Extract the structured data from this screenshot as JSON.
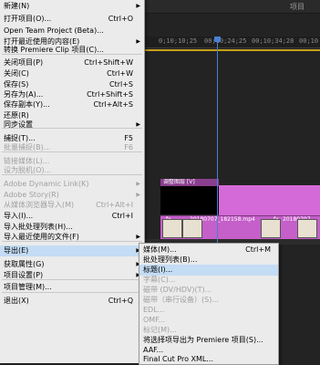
{
  "app": {
    "panel_title": "项目"
  },
  "timeline": {
    "timecodes": [
      "0;10;10;25",
      "00;10;24;25",
      "00;10;34;28",
      "00;10"
    ],
    "clip_label": "调整图层 [V]",
    "video_clip_labels": [
      "fx",
      "20180707_182158.mp4",
      "fx",
      "20180707_"
    ],
    "colors": {
      "playhead": "#4a7fd0",
      "clip": "#d46ad8",
      "workbar": "#c8a018"
    }
  },
  "file_menu": {
    "items": [
      {
        "label": "新建(N)",
        "shortcut": "",
        "submenu": true,
        "disabled": false
      },
      {
        "label": "打开项目(O)...",
        "shortcut": "Ctrl+O",
        "submenu": false,
        "disabled": false
      },
      {
        "label": "Open Team Project (Beta)...",
        "shortcut": "",
        "submenu": false,
        "disabled": false
      },
      {
        "label": "打开最近使用的内容(E)",
        "shortcut": "",
        "submenu": true,
        "disabled": false
      },
      {
        "label": "转换 Premiere Clip 项目(C)...",
        "shortcut": "",
        "submenu": false,
        "disabled": false
      },
      {
        "label": "关闭项目(P)",
        "shortcut": "Ctrl+Shift+W",
        "submenu": false,
        "disabled": false
      },
      {
        "label": "关闭(C)",
        "shortcut": "Ctrl+W",
        "submenu": false,
        "disabled": false
      },
      {
        "label": "保存(S)",
        "shortcut": "Ctrl+S",
        "submenu": false,
        "disabled": false
      },
      {
        "label": "另存为(A)...",
        "shortcut": "Ctrl+Shift+S",
        "submenu": false,
        "disabled": false
      },
      {
        "label": "保存副本(Y)...",
        "shortcut": "Ctrl+Alt+S",
        "submenu": false,
        "disabled": false
      },
      {
        "label": "还原(R)",
        "shortcut": "",
        "submenu": false,
        "disabled": false
      },
      {
        "label": "同步设置",
        "shortcut": "",
        "submenu": true,
        "disabled": false
      },
      {
        "label": "捕捉(T)...",
        "shortcut": "F5",
        "submenu": false,
        "disabled": false
      },
      {
        "label": "批量捕捉(B)...",
        "shortcut": "F6",
        "submenu": false,
        "disabled": true
      },
      {
        "label": "链接媒体(L)...",
        "shortcut": "",
        "submenu": false,
        "disabled": true
      },
      {
        "label": "设为脱机(O)...",
        "shortcut": "",
        "submenu": false,
        "disabled": true
      },
      {
        "label": "Adobe Dynamic Link(K)",
        "shortcut": "",
        "submenu": true,
        "disabled": true
      },
      {
        "label": "Adobe Story(R)",
        "shortcut": "",
        "submenu": true,
        "disabled": true
      },
      {
        "label": "从媒体浏览器导入(M)",
        "shortcut": "Ctrl+Alt+I",
        "submenu": false,
        "disabled": true
      },
      {
        "label": "导入(I)...",
        "shortcut": "Ctrl+I",
        "submenu": false,
        "disabled": false
      },
      {
        "label": "导入批处理列表(H)...",
        "shortcut": "",
        "submenu": false,
        "disabled": false
      },
      {
        "label": "导入最近使用的文件(F)",
        "shortcut": "",
        "submenu": true,
        "disabled": false
      },
      {
        "label": "导出(E)",
        "shortcut": "",
        "submenu": true,
        "disabled": false,
        "highlighted": true
      },
      {
        "label": "获取属性(G)",
        "shortcut": "",
        "submenu": true,
        "disabled": false
      },
      {
        "label": "项目设置(P)",
        "shortcut": "",
        "submenu": true,
        "disabled": false
      },
      {
        "label": "项目管理(M)...",
        "shortcut": "",
        "submenu": false,
        "disabled": false
      },
      {
        "label": "退出(X)",
        "shortcut": "Ctrl+Q",
        "submenu": false,
        "disabled": false
      }
    ]
  },
  "export_submenu": {
    "items": [
      {
        "label": "媒体(M)...",
        "shortcut": "Ctrl+M",
        "disabled": false
      },
      {
        "label": "批处理列表(B)...",
        "shortcut": "",
        "disabled": false
      },
      {
        "label": "标题(I)...",
        "shortcut": "",
        "disabled": false,
        "highlighted": true
      },
      {
        "label": "字幕(C)...",
        "shortcut": "",
        "disabled": true
      },
      {
        "label": "磁带 (DV/HDV)(T)...",
        "shortcut": "",
        "disabled": true
      },
      {
        "label": "磁带（串行设备）(S)...",
        "shortcut": "",
        "disabled": true
      },
      {
        "label": "EDL...",
        "shortcut": "",
        "disabled": true
      },
      {
        "label": "OMF...",
        "shortcut": "",
        "disabled": true
      },
      {
        "label": "标记(M)...",
        "shortcut": "",
        "disabled": true
      },
      {
        "label": "将选择项导出为 Premiere 项目(S)...",
        "shortcut": "",
        "disabled": false
      },
      {
        "label": "AAF...",
        "shortcut": "",
        "disabled": false
      },
      {
        "label": "Final Cut Pro XML...",
        "shortcut": "",
        "disabled": false
      }
    ]
  }
}
